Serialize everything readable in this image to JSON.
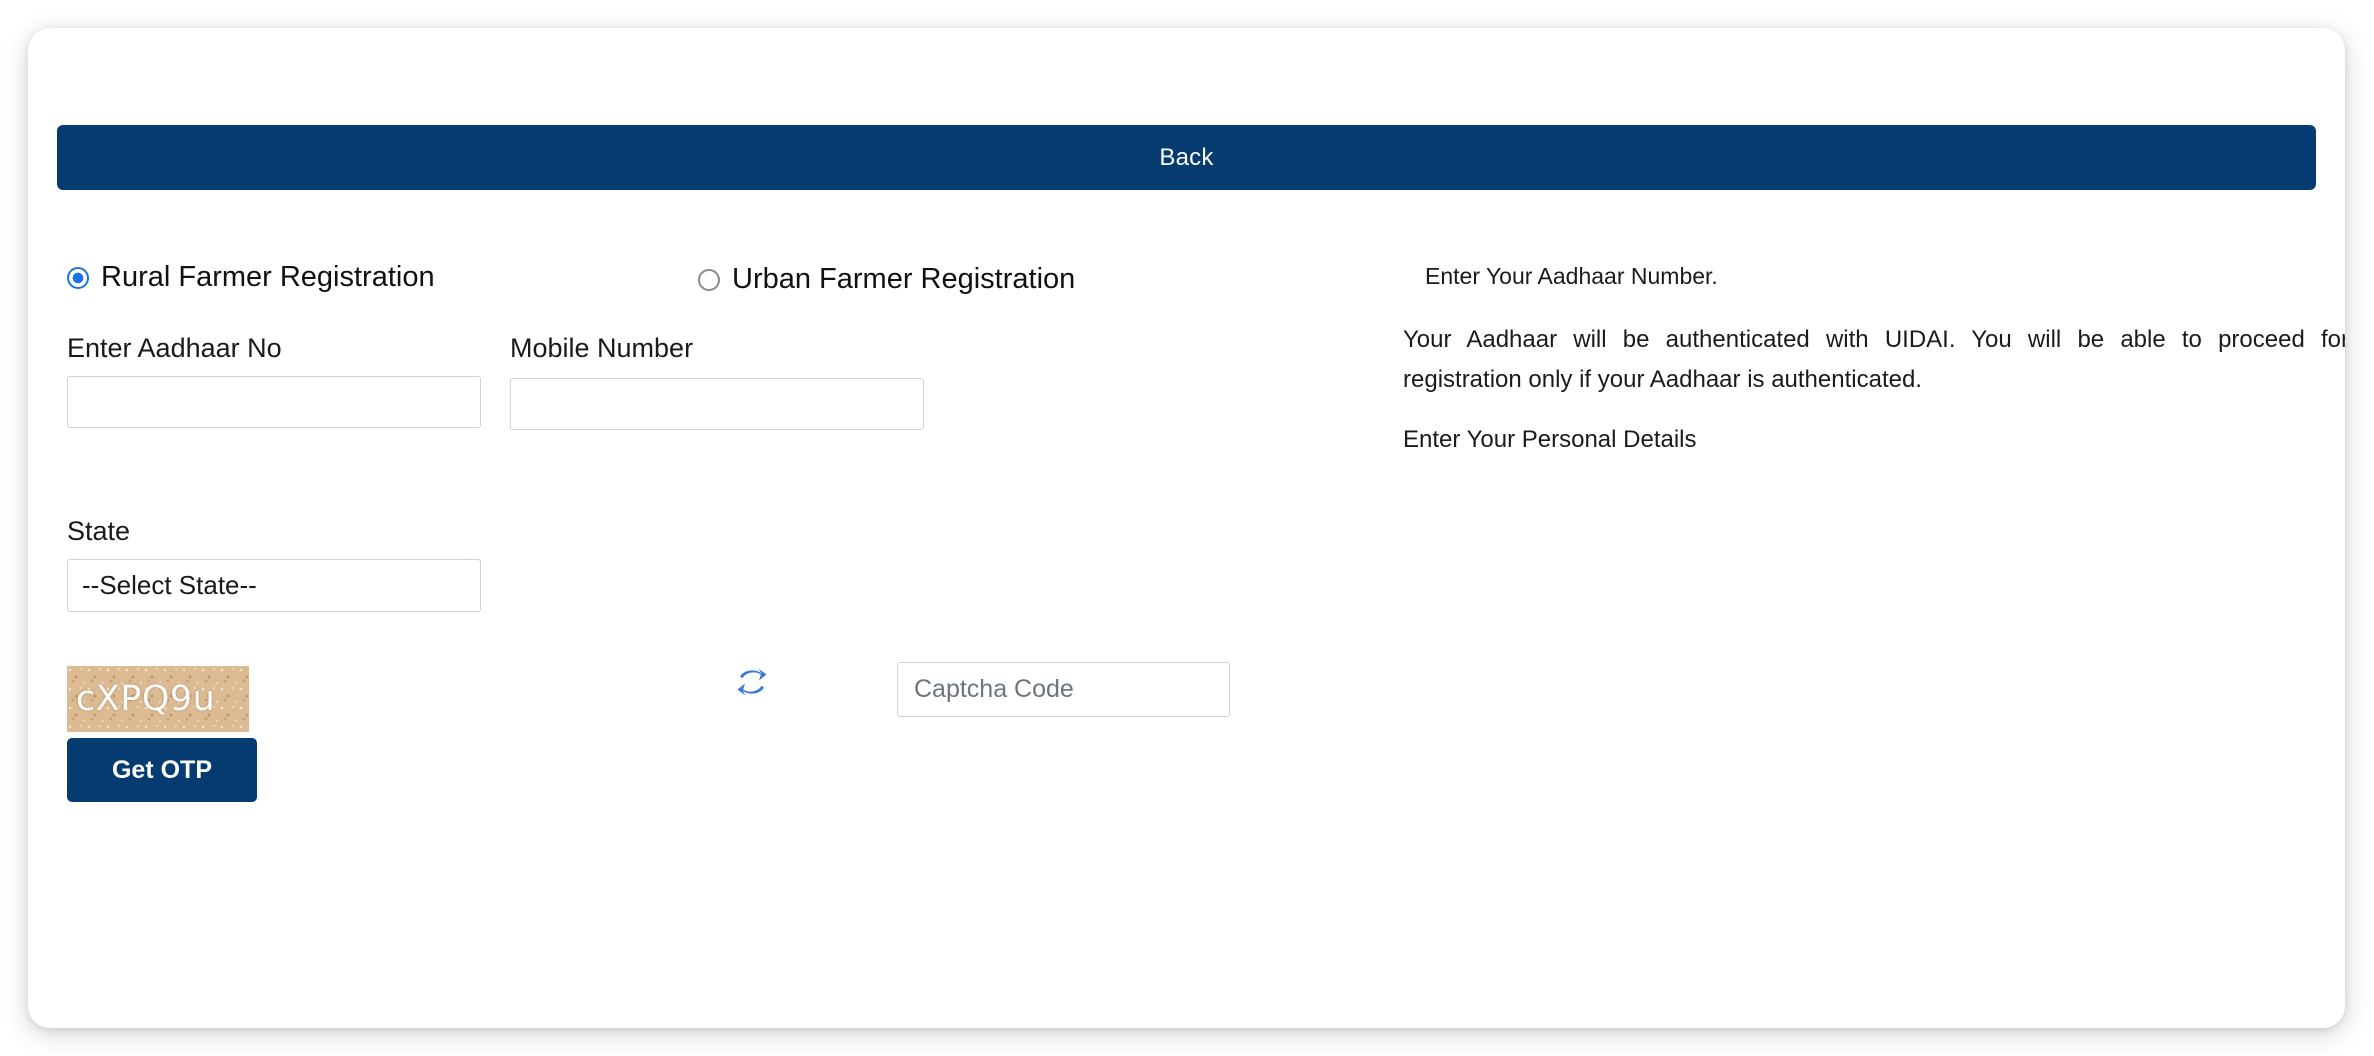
{
  "card": {
    "back_bar": {
      "label": "Back"
    }
  },
  "form": {
    "registration_type": {
      "rural": {
        "label": "Rural Farmer Registration",
        "selected": true
      },
      "urban": {
        "label": "Urban Farmer Registration",
        "selected": false
      }
    },
    "aadhaar": {
      "label": "Enter Aadhaar No",
      "value": "",
      "placeholder": "",
      "reveal_icon": "eye-icon"
    },
    "mobile": {
      "label": "Mobile Number",
      "value": "",
      "placeholder": ""
    },
    "state": {
      "label": "State",
      "selected_option": "--Select State--"
    },
    "captcha": {
      "code_image_text": "cXPQ9u",
      "refresh_icon": "refresh-icon",
      "input_value": "",
      "input_placeholder": "Captcha Code"
    },
    "submit": {
      "label": "Get OTP"
    }
  },
  "info": {
    "lead": "Enter Your Aadhaar Number.",
    "paragraph": "Your Aadhaar will be authenticated with UIDAI. You will be able to proceed for registration only if your Aadhaar is authenticated.",
    "tail": "Enter Your Personal Details"
  },
  "colors": {
    "navy": "#063b72",
    "radio_blue": "#1a73e8",
    "refresh_blue": "#3b78d8",
    "captcha_bg": "#dcbb93",
    "input_border": "#ccd2de",
    "placeholder": "#6c757d"
  }
}
